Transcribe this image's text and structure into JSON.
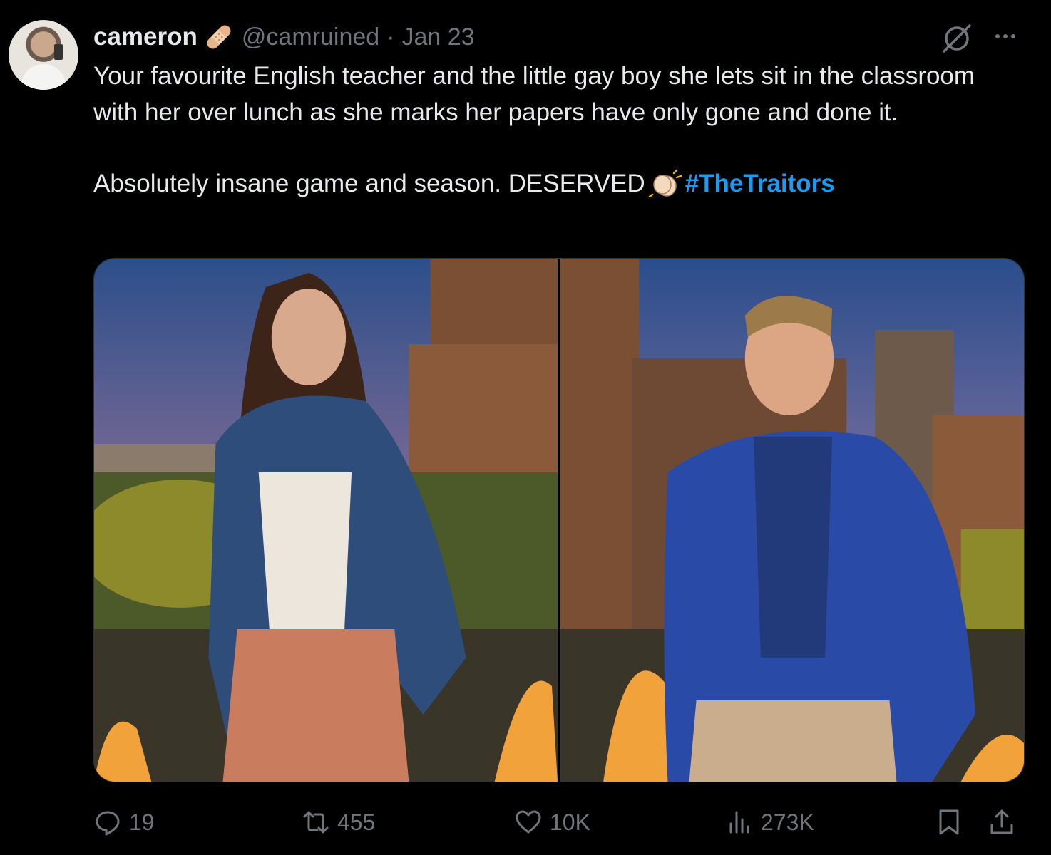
{
  "tweet": {
    "author_name": "cameron",
    "author_badge_icon": "bandage-icon",
    "author_handle": "@camruined",
    "separator": "·",
    "date": "Jan 23",
    "body_line_1": "Your favourite English teacher and the little gay boy she lets sit in the classroom with her over lunch as she marks her papers have only gone and done it.",
    "body_line_2": "Absolutely insane game and season. DESERVED",
    "emoji_icon": "clapping-hands-icon",
    "hashtag": "#TheTraitors",
    "hashtag_color": "#1d9bf0"
  },
  "media": {
    "images": [
      {
        "icon": "woman-denim-jacket-castle-photo"
      },
      {
        "icon": "man-blue-jacket-castle-photo"
      }
    ]
  },
  "actions": {
    "reply_count": "19",
    "retweet_count": "455",
    "like_count": "10K",
    "views_count": "273K"
  },
  "colors": {
    "background": "#000000",
    "text_primary": "#e7e9ea",
    "text_secondary": "#71767b",
    "accent": "#1d9bf0"
  }
}
